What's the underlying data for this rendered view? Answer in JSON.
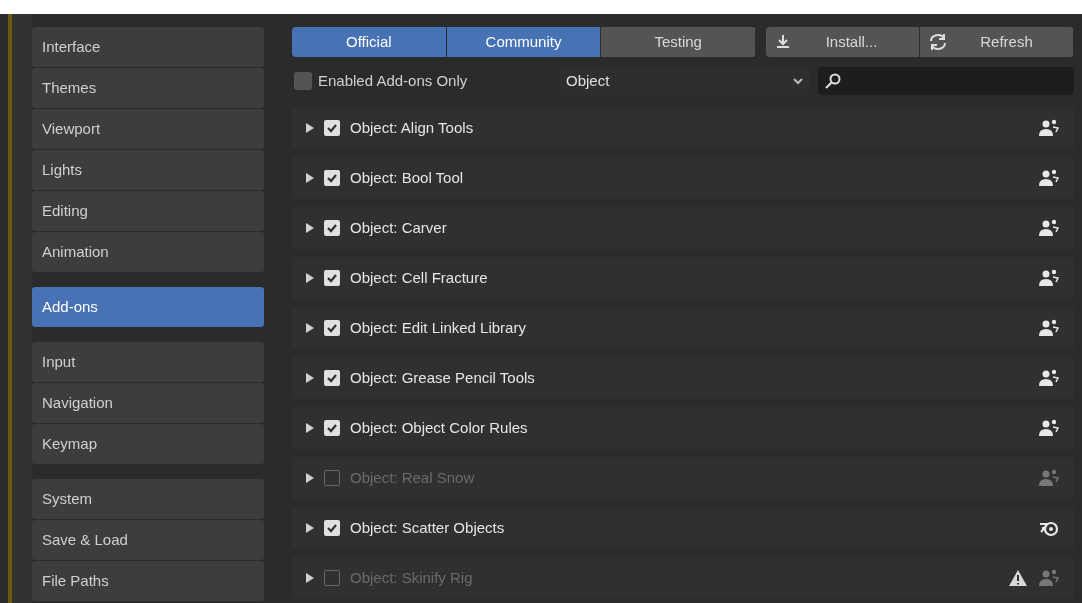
{
  "sidebar": {
    "groups": [
      {
        "items": [
          {
            "label": "Interface",
            "selected": false
          },
          {
            "label": "Themes",
            "selected": false
          },
          {
            "label": "Viewport",
            "selected": false
          },
          {
            "label": "Lights",
            "selected": false
          },
          {
            "label": "Editing",
            "selected": false
          },
          {
            "label": "Animation",
            "selected": false
          }
        ]
      },
      {
        "items": [
          {
            "label": "Add-ons",
            "selected": true
          }
        ]
      },
      {
        "items": [
          {
            "label": "Input",
            "selected": false
          },
          {
            "label": "Navigation",
            "selected": false
          },
          {
            "label": "Keymap",
            "selected": false
          }
        ]
      },
      {
        "items": [
          {
            "label": "System",
            "selected": false
          },
          {
            "label": "Save & Load",
            "selected": false
          },
          {
            "label": "File Paths",
            "selected": false
          }
        ]
      }
    ]
  },
  "support_tabs": [
    {
      "label": "Official",
      "selected": true
    },
    {
      "label": "Community",
      "selected": true
    },
    {
      "label": "Testing",
      "selected": false
    }
  ],
  "actions": [
    {
      "kind": "install",
      "label": "Install..."
    },
    {
      "kind": "refresh",
      "label": "Refresh"
    }
  ],
  "filter": {
    "enabled_only": {
      "label": "Enabled Add-ons Only",
      "checked": false
    },
    "category": "Object"
  },
  "addons": [
    {
      "name": "Object: Align Tools",
      "enabled": true,
      "kind": "community",
      "warning": false
    },
    {
      "name": "Object: Bool Tool",
      "enabled": true,
      "kind": "community",
      "warning": false
    },
    {
      "name": "Object: Carver",
      "enabled": true,
      "kind": "community",
      "warning": false
    },
    {
      "name": "Object: Cell Fracture",
      "enabled": true,
      "kind": "community",
      "warning": false
    },
    {
      "name": "Object: Edit Linked Library",
      "enabled": true,
      "kind": "community",
      "warning": false
    },
    {
      "name": "Object: Grease Pencil Tools",
      "enabled": true,
      "kind": "community",
      "warning": false
    },
    {
      "name": "Object: Object Color Rules",
      "enabled": true,
      "kind": "community",
      "warning": false
    },
    {
      "name": "Object: Real Snow",
      "enabled": false,
      "kind": "community",
      "warning": false
    },
    {
      "name": "Object: Scatter Objects",
      "enabled": true,
      "kind": "official",
      "warning": false
    },
    {
      "name": "Object: Skinify Rig",
      "enabled": false,
      "kind": "community",
      "warning": true
    }
  ]
}
